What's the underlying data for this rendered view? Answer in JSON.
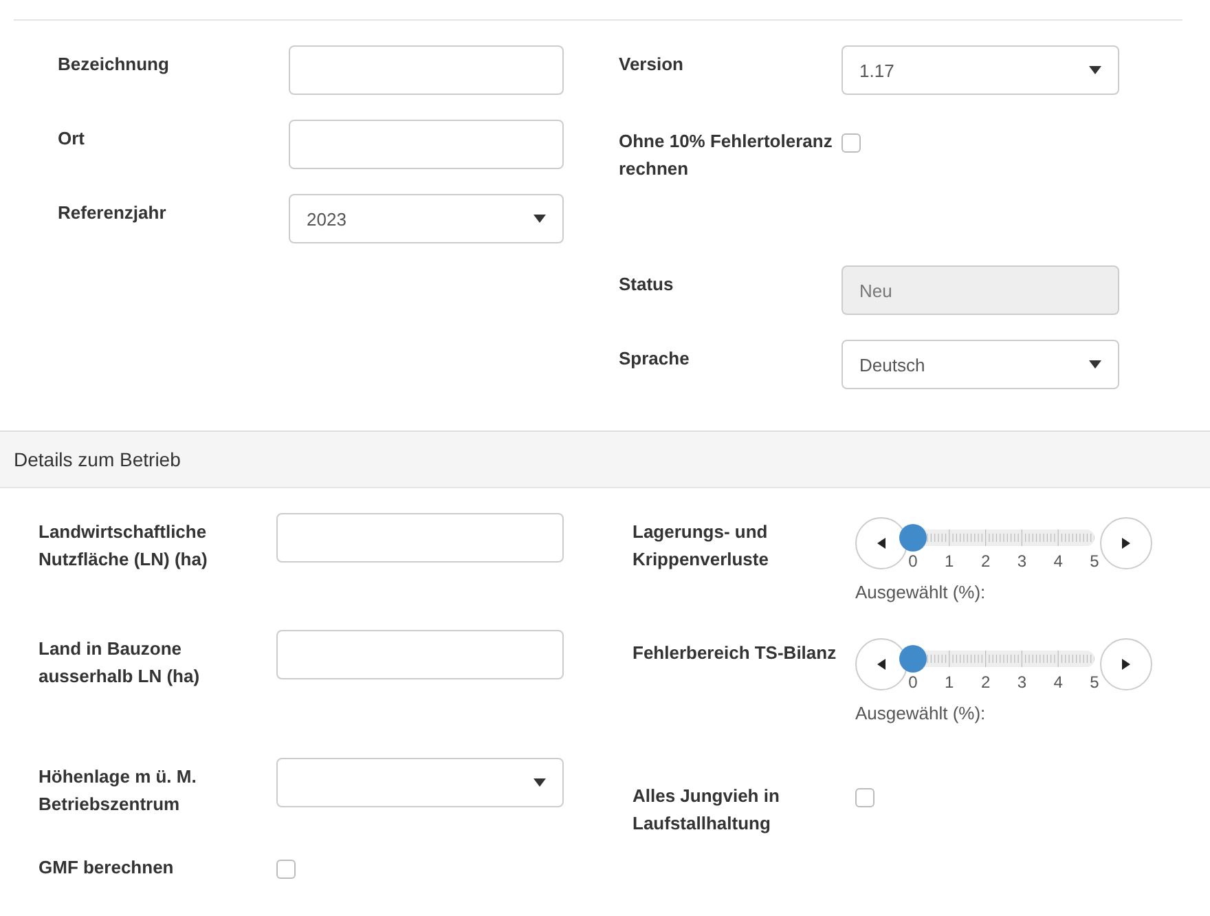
{
  "general": {
    "left": [
      {
        "label": "Bezeichnung",
        "kind": "text"
      },
      {
        "label": "Ort",
        "kind": "text"
      },
      {
        "label": "Referenzjahr",
        "kind": "select",
        "value": "2023"
      }
    ],
    "right": [
      {
        "label": "Version",
        "kind": "select",
        "value": "1.17"
      },
      {
        "label": "Ohne 10% Fehlertoleranz rechnen",
        "kind": "checkbox",
        "checked": false
      },
      {
        "label": "Status",
        "kind": "readonly",
        "value": "Neu"
      },
      {
        "label": "Sprache",
        "kind": "select",
        "value": "Deutsch"
      }
    ]
  },
  "details": {
    "title": "Details zum Betrieb",
    "left": [
      {
        "label": "Landwirtschaftliche Nutzfläche (LN) (ha)",
        "kind": "text"
      },
      {
        "label": "Land in Bauzone ausserhalb LN (ha)",
        "kind": "text"
      },
      {
        "label": "Höhenlage m ü. M. Betriebszentrum",
        "kind": "select"
      },
      {
        "label": "GMF berechnen",
        "kind": "checkbox",
        "checked": false
      }
    ],
    "right": [
      {
        "label": "Lagerungs- und Krippenverluste",
        "kind": "slider",
        "level": 0,
        "ticks": [
          "0",
          "1",
          "2",
          "3",
          "4",
          "5"
        ],
        "reading": "Ausgewählt (%):"
      },
      {
        "label": "Fehlerbereich TS-Bilanz",
        "kind": "slider",
        "level": 0,
        "ticks": [
          "0",
          "1",
          "2",
          "3",
          "4",
          "5"
        ],
        "reading": "Ausgewählt (%):"
      },
      {
        "label": "Alles Jungvieh in Laufstallhaltung",
        "kind": "checkbox",
        "checked": false
      }
    ]
  }
}
